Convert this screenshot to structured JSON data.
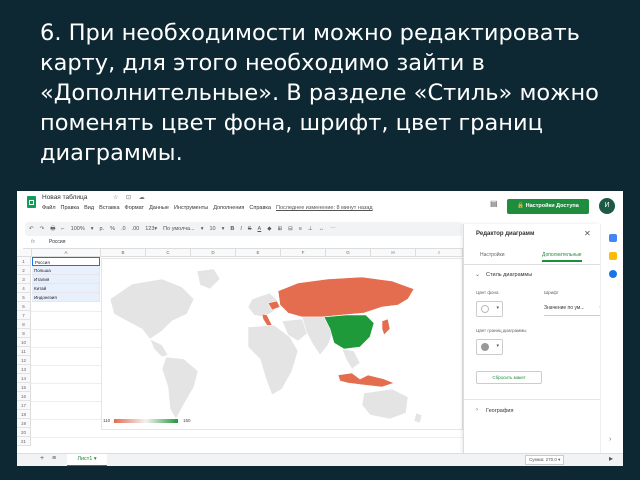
{
  "slide": {
    "caption": "6. При необходимости можно редактировать карту, для этого необходимо зайти в «Дополнительные». В разделе «Стиль» можно поменять цвет фона, шрифт,  цвет границ диаграммы."
  },
  "doc": {
    "title": "Новая таблица",
    "title_icons": "☆ ⊡ ☁",
    "menu": [
      "Файл",
      "Правка",
      "Вид",
      "Вставка",
      "Формат",
      "Данные",
      "Инструменты",
      "Дополнения",
      "Справка"
    ],
    "last_edit": "Последнее изменение: 8 минут назад"
  },
  "header": {
    "comment_icon": "comment-icon",
    "share_label": "🔒 Настройки Доступа",
    "avatar_letter": "И"
  },
  "toolbar": {
    "items": [
      "↶",
      "↷",
      "🖶",
      "⌐",
      "100%",
      "▾",
      "р.",
      "%",
      ".0",
      ".00",
      "123▾",
      "По умолча...",
      "▾",
      "10",
      "▾",
      "B",
      "I",
      "S",
      "A",
      "◆",
      "⊞",
      "⊟",
      "≡",
      "⊥",
      "↔",
      "⋯"
    ]
  },
  "formula_bar": {
    "fx": "fx",
    "value": "Россия"
  },
  "grid": {
    "columns": [
      "A",
      "B",
      "C",
      "D",
      "E",
      "F",
      "G",
      "H",
      "I"
    ],
    "rows": [
      "1",
      "2",
      "3",
      "4",
      "5",
      "6",
      "7",
      "8",
      "9",
      "10",
      "11",
      "12",
      "13",
      "14",
      "15",
      "16",
      "17",
      "18",
      "19",
      "20",
      "21"
    ],
    "cells": [
      "Россия",
      "Польша",
      "Италия",
      "Китай",
      "Индонезия"
    ],
    "cell_b1": "140"
  },
  "chart": {
    "legend_min": "110",
    "legend_max": "150",
    "colors": {
      "low": "#e56d4f",
      "mid": "#f3f3f3",
      "high": "#1f9a3a",
      "land": "#e4e4e4"
    }
  },
  "editor": {
    "title": "Редактор диаграмм",
    "close": "✕",
    "tabs": [
      "Настройки",
      "Дополнительные"
    ],
    "section_style": "Стиль диаграммы",
    "bg_color_label": "Цвет фона",
    "font_label": "Шрифт",
    "font_value": "Значение по ум...",
    "border_label": "Цвет границ диаграммы",
    "reset_label": "Сбросить макет",
    "section_geo": "География"
  },
  "sheets": {
    "add": "+",
    "list": "≡",
    "tab": "Лист1 ▾",
    "sum": "Сумма: 270.0 ▾",
    "explore": "▸"
  }
}
